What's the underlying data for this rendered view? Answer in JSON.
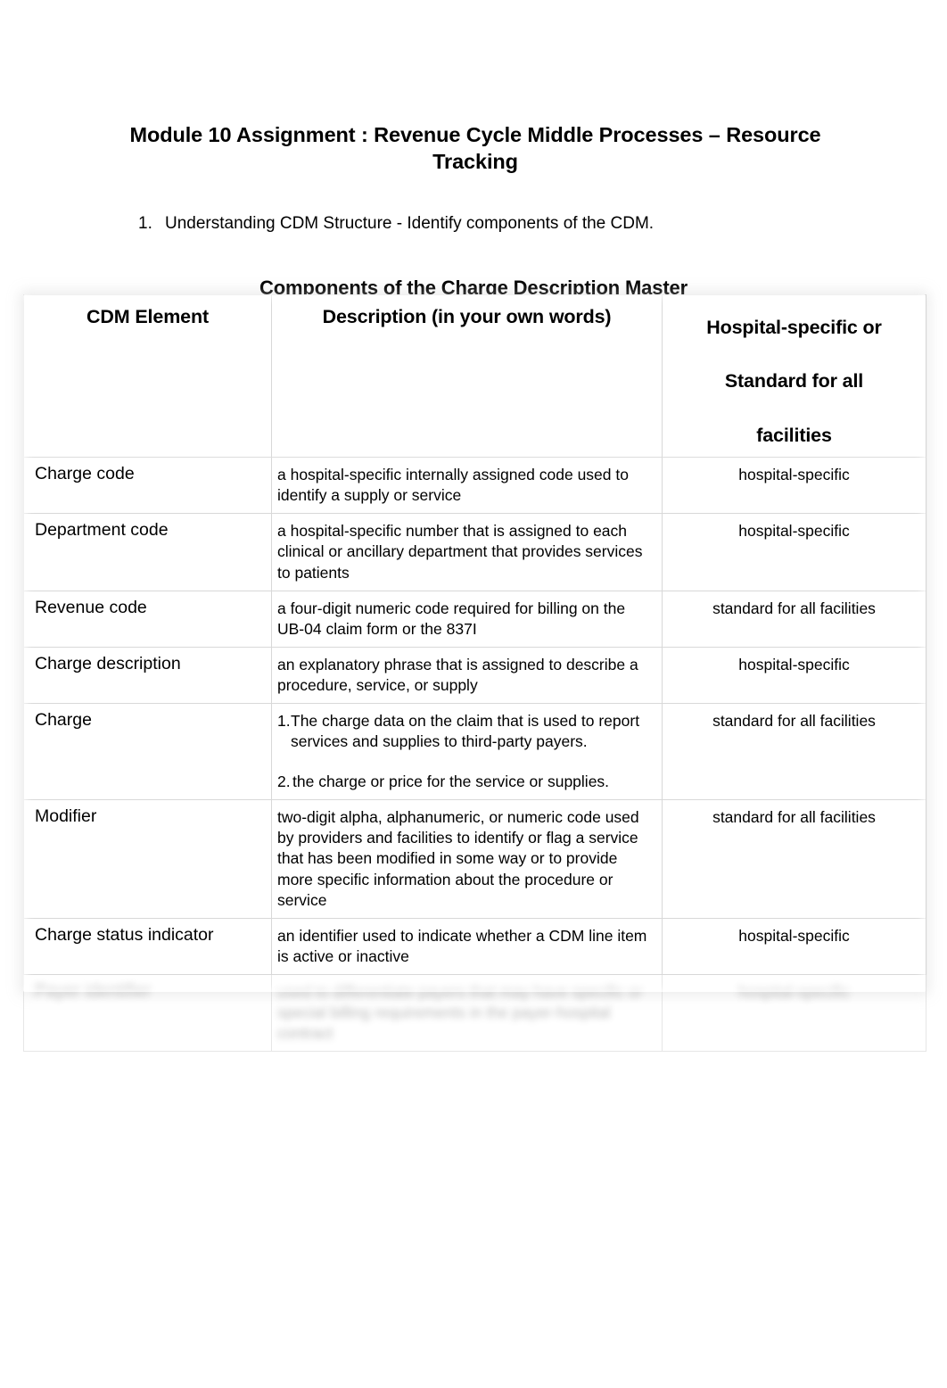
{
  "document": {
    "title": "Module 10 Assignment : Revenue Cycle Middle Processes – Resource Tracking",
    "prompt_number": "1.",
    "prompt_text": "Understanding CDM Structure - Identify components of the CDM.",
    "table_caption": "Components of the Charge Description Master"
  },
  "table": {
    "headers": {
      "col1": "CDM Element",
      "col2": "Description (in your own words)",
      "col3_line1": "Hospital-specific or",
      "col3_line2": "Standard for all",
      "col3_line3": "facilities"
    },
    "rows": [
      {
        "element": "Charge code",
        "description": "a hospital-specific internally assigned code used to identify a supply or service",
        "scope": "hospital-specific"
      },
      {
        "element": "Department code",
        "description": "a hospital-specific number that is assigned to each clinical or ancillary department that provides services to patients",
        "scope": "hospital-specific"
      },
      {
        "element": "Revenue code",
        "description": "a four-digit numeric code required for billing on the UB-04 claim form or the 837I",
        "scope": "standard for all facilities"
      },
      {
        "element": "Charge description",
        "description": "an explanatory phrase that is assigned to describe a procedure, service, or supply",
        "scope": "hospital-specific"
      },
      {
        "element": "Charge",
        "description_items": [
          {
            "marker": "1.",
            "text": "The charge data on the claim that is used to report services and supplies to third-party payers."
          },
          {
            "marker": "2.",
            "text": "the charge or price for the service or supplies."
          }
        ],
        "scope": "standard for all facilities"
      },
      {
        "element": "Modifier",
        "description": "two-digit alpha, alphanumeric, or numeric code used by providers and facilities to identify or flag a service that has been modified in some way or to provide more specific information about the procedure or service",
        "scope": "standard for all facilities"
      },
      {
        "element": "Charge status indicator",
        "description": "an identifier used to indicate whether a CDM line item is active or inactive",
        "scope": "hospital-specific"
      },
      {
        "element": "Payer identifier",
        "description": "used to differentiate payers that may have specific or special billing requirements in the payer-hospital contract",
        "scope": "hospital-specific",
        "redacted": true
      }
    ]
  },
  "colors": {
    "text": "#000000",
    "border": "#d8d8d8",
    "background": "#ffffff"
  }
}
